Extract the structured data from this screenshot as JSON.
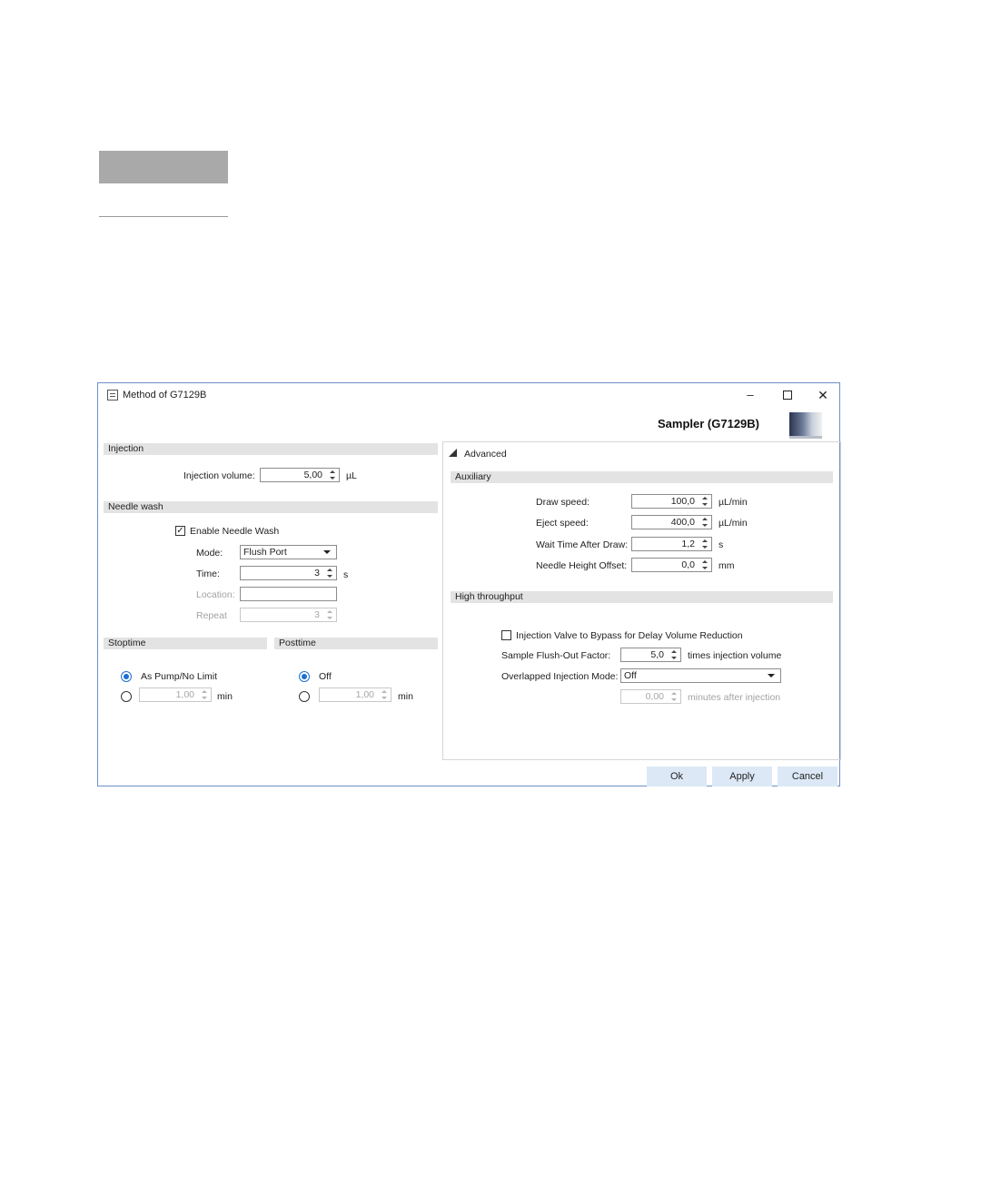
{
  "window": {
    "title": "Method of G7129B",
    "minimize_glyph": "–",
    "close_glyph": "✕",
    "module_title": "Sampler (G7129B)"
  },
  "left": {
    "injection": {
      "header": "Injection",
      "volume_label": "Injection volume:",
      "volume_value": "5,00",
      "volume_unit": "µL"
    },
    "needle_wash": {
      "header": "Needle wash",
      "enable_label": "Enable Needle Wash",
      "enable_checked": true,
      "mode_label": "Mode:",
      "mode_value": "Flush Port",
      "time_label": "Time:",
      "time_value": "3",
      "time_unit": "s",
      "location_label": "Location:",
      "location_value": "",
      "repeat_label": "Repeat",
      "repeat_value": "3"
    },
    "stoptime": {
      "header": "Stoptime",
      "option1_label": "As Pump/No Limit",
      "option1_selected": true,
      "value": "1,00",
      "unit": "min"
    },
    "posttime": {
      "header": "Posttime",
      "option1_label": "Off",
      "option1_selected": true,
      "value": "1,00",
      "unit": "min"
    }
  },
  "advanced": {
    "label": "Advanced",
    "auxiliary": {
      "header": "Auxiliary",
      "draw_speed_label": "Draw speed:",
      "draw_speed_value": "100,0",
      "draw_speed_unit": "µL/min",
      "eject_speed_label": "Eject speed:",
      "eject_speed_value": "400,0",
      "eject_speed_unit": "µL/min",
      "wait_time_label": "Wait Time After Draw:",
      "wait_time_value": "1,2",
      "wait_time_unit": "s",
      "needle_height_label": "Needle Height Offset:",
      "needle_height_value": "0,0",
      "needle_height_unit": "mm"
    },
    "high_throughput": {
      "header": "High throughput",
      "bypass_label": "Injection Valve to Bypass for Delay Volume Reduction",
      "bypass_checked": false,
      "flush_label": "Sample Flush-Out Factor:",
      "flush_value": "5,0",
      "flush_unit": "times injection volume",
      "overlap_label": "Overlapped Injection Mode:",
      "overlap_value": "Off",
      "minutes_value": "0,00",
      "minutes_unit": "minutes after injection"
    }
  },
  "buttons": {
    "ok": "Ok",
    "apply": "Apply",
    "cancel": "Cancel"
  },
  "colors": {
    "dialog_border": "#6c8fc9",
    "section_header": "#e3e3e3",
    "button_bg": "#dce8f6",
    "radio_accent": "#1c6fd1"
  }
}
